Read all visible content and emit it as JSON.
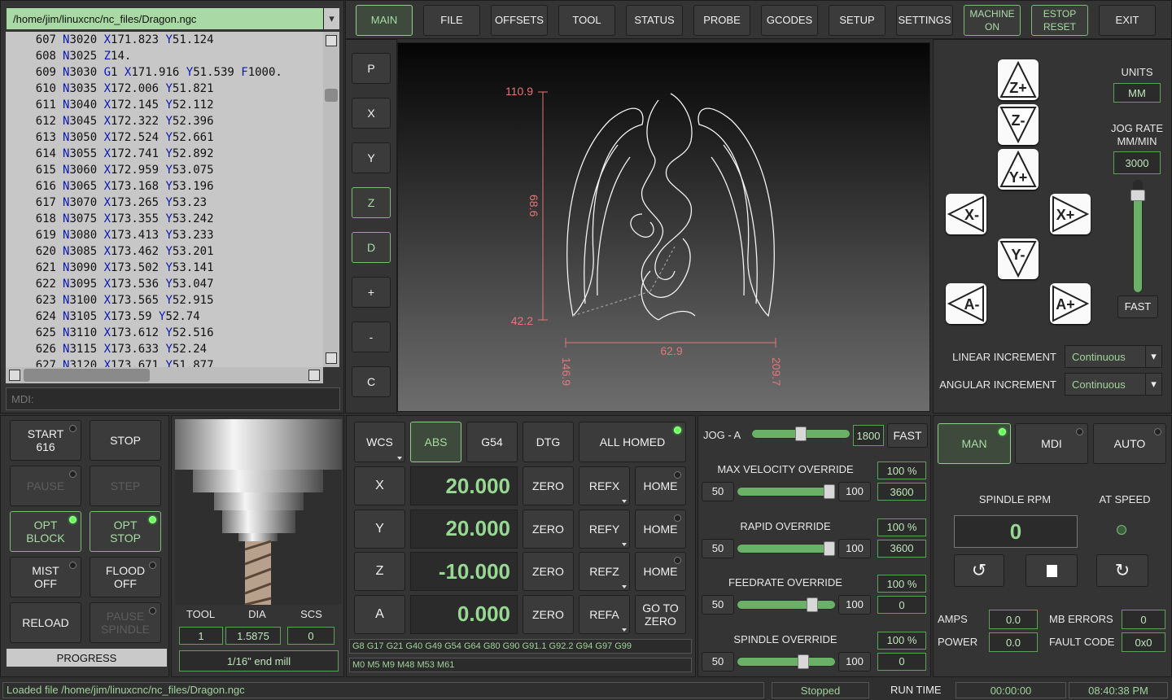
{
  "file_path": "/home/jim/linuxcnc/nc_files/Dragon.ngc",
  "gcode_lines": [
    {
      "n": "607",
      "t": [
        [
          "N",
          "3020"
        ],
        [
          "X",
          "171.823"
        ],
        [
          "Y",
          "51.124"
        ]
      ]
    },
    {
      "n": "608",
      "t": [
        [
          "N",
          "3025"
        ],
        [
          "Z",
          "14."
        ]
      ]
    },
    {
      "n": "609",
      "t": [
        [
          "N",
          "3030"
        ],
        [
          "G",
          "1"
        ],
        [
          "X",
          "171.916"
        ],
        [
          "Y",
          "51.539"
        ],
        [
          "F",
          "1000."
        ]
      ]
    },
    {
      "n": "610",
      "t": [
        [
          "N",
          "3035"
        ],
        [
          "X",
          "172.006"
        ],
        [
          "Y",
          "51.821"
        ]
      ]
    },
    {
      "n": "611",
      "t": [
        [
          "N",
          "3040"
        ],
        [
          "X",
          "172.145"
        ],
        [
          "Y",
          "52.112"
        ]
      ]
    },
    {
      "n": "612",
      "t": [
        [
          "N",
          "3045"
        ],
        [
          "X",
          "172.322"
        ],
        [
          "Y",
          "52.396"
        ]
      ]
    },
    {
      "n": "613",
      "t": [
        [
          "N",
          "3050"
        ],
        [
          "X",
          "172.524"
        ],
        [
          "Y",
          "52.661"
        ]
      ]
    },
    {
      "n": "614",
      "t": [
        [
          "N",
          "3055"
        ],
        [
          "X",
          "172.741"
        ],
        [
          "Y",
          "52.892"
        ]
      ]
    },
    {
      "n": "615",
      "t": [
        [
          "N",
          "3060"
        ],
        [
          "X",
          "172.959"
        ],
        [
          "Y",
          "53.075"
        ]
      ]
    },
    {
      "n": "616",
      "t": [
        [
          "N",
          "3065"
        ],
        [
          "X",
          "173.168"
        ],
        [
          "Y",
          "53.196"
        ]
      ]
    },
    {
      "n": "617",
      "t": [
        [
          "N",
          "3070"
        ],
        [
          "X",
          "173.265"
        ],
        [
          "Y",
          "53.23"
        ]
      ]
    },
    {
      "n": "618",
      "t": [
        [
          "N",
          "3075"
        ],
        [
          "X",
          "173.355"
        ],
        [
          "Y",
          "53.242"
        ]
      ]
    },
    {
      "n": "619",
      "t": [
        [
          "N",
          "3080"
        ],
        [
          "X",
          "173.413"
        ],
        [
          "Y",
          "53.233"
        ]
      ]
    },
    {
      "n": "620",
      "t": [
        [
          "N",
          "3085"
        ],
        [
          "X",
          "173.462"
        ],
        [
          "Y",
          "53.201"
        ]
      ]
    },
    {
      "n": "621",
      "t": [
        [
          "N",
          "3090"
        ],
        [
          "X",
          "173.502"
        ],
        [
          "Y",
          "53.141"
        ]
      ]
    },
    {
      "n": "622",
      "t": [
        [
          "N",
          "3095"
        ],
        [
          "X",
          "173.536"
        ],
        [
          "Y",
          "53.047"
        ]
      ]
    },
    {
      "n": "623",
      "t": [
        [
          "N",
          "3100"
        ],
        [
          "X",
          "173.565"
        ],
        [
          "Y",
          "52.915"
        ]
      ]
    },
    {
      "n": "624",
      "t": [
        [
          "N",
          "3105"
        ],
        [
          "X",
          "173.59"
        ],
        [
          "Y",
          "52.74"
        ]
      ]
    },
    {
      "n": "625",
      "t": [
        [
          "N",
          "3110"
        ],
        [
          "X",
          "173.612"
        ],
        [
          "Y",
          "52.516"
        ]
      ]
    },
    {
      "n": "626",
      "t": [
        [
          "N",
          "3115"
        ],
        [
          "X",
          "173.633"
        ],
        [
          "Y",
          "52.24"
        ]
      ]
    },
    {
      "n": "627",
      "t": [
        [
          "N",
          "3120"
        ],
        [
          "X",
          "173.671"
        ],
        [
          "Y",
          "51.877"
        ]
      ]
    }
  ],
  "mdi_label": "MDI:",
  "tabs": [
    "MAIN",
    "FILE",
    "OFFSETS",
    "TOOL",
    "STATUS",
    "PROBE",
    "GCODES",
    "SETUP",
    "SETTINGS",
    "MACHINE ON",
    "ESTOP RESET",
    "EXIT"
  ],
  "side_buttons": [
    "P",
    "X",
    "Y",
    "Z",
    "D",
    "+",
    "-",
    "C"
  ],
  "preview": {
    "y_top": "110.9",
    "y_bottom": "42.2",
    "height": "68.6",
    "width": "62.9",
    "x_left": "146.9",
    "x_right": "209.7"
  },
  "jog": {
    "z_plus": "Z+",
    "z_minus": "Z-",
    "y_plus": "Y+",
    "y_minus": "Y-",
    "x_plus": "X+",
    "x_minus": "X-",
    "a_plus": "A+",
    "a_minus": "A-",
    "units_label": "UNITS",
    "units": "MM",
    "rate_label": "JOG RATE\nMM/MIN",
    "rate": "3000",
    "rate_level": 0.9,
    "fast": "FAST",
    "linear_label": "LINEAR INCREMENT",
    "linear_value": "Continuous",
    "angular_label": "ANGULAR INCREMENT",
    "angular_value": "Continuous"
  },
  "cycle": {
    "start": "START\n616",
    "stop": "STOP",
    "pause": "PAUSE",
    "step": "STEP",
    "opt_block": "OPT\nBLOCK",
    "opt_stop": "OPT\nSTOP",
    "mist": "MIST\nOFF",
    "flood": "FLOOD\nOFF",
    "reload": "RELOAD",
    "pause_spindle": "PAUSE\nSPINDLE",
    "progress": "PROGRESS"
  },
  "tool": {
    "tool_label": "TOOL",
    "dia_label": "DIA",
    "scs_label": "SCS",
    "tool": "1",
    "dia": "1.5875",
    "scs": "0",
    "desc": "1/16\" end mill"
  },
  "dro": {
    "wcs": "WCS",
    "abs": "ABS",
    "g54": "G54",
    "dtg": "DTG",
    "all_homed": "ALL HOMED",
    "axes": [
      {
        "name": "X",
        "value": "20.000",
        "ref": "REFX",
        "home": "HOME"
      },
      {
        "name": "Y",
        "value": "20.000",
        "ref": "REFY",
        "home": "HOME"
      },
      {
        "name": "Z",
        "value": "-10.000",
        "ref": "REFZ",
        "home": "HOME"
      },
      {
        "name": "A",
        "value": "0.000",
        "ref": "REFA",
        "home": "GO TO\nZERO"
      }
    ],
    "zero": "ZERO",
    "gcodes": "G8 G17 G21 G40 G49 G54 G64 G80 G90 G91.1 G92.2 G94 G97 G99",
    "mcodes": "M0 M5 M9 M48 M53 M61"
  },
  "overrides": {
    "jog_label": "JOG - A",
    "jog_value": "1800",
    "jog_level": 0.5,
    "fast": "FAST",
    "items": [
      {
        "label": "MAX VELOCITY OVERRIDE",
        "min": "50",
        "max": "100",
        "pct": "100 %",
        "val": "3600",
        "level": 1.0
      },
      {
        "label": "RAPID OVERRIDE",
        "min": "50",
        "max": "100",
        "pct": "100 %",
        "val": "3600",
        "level": 1.0
      },
      {
        "label": "FEEDRATE OVERRIDE",
        "min": "50",
        "max": "100",
        "pct": "100 %",
        "val": "0",
        "level": 0.8
      },
      {
        "label": "SPINDLE OVERRIDE",
        "min": "50",
        "max": "100",
        "pct": "100 %",
        "val": "0",
        "level": 0.7
      }
    ]
  },
  "spindle": {
    "man": "MAN",
    "mdi": "MDI",
    "auto": "AUTO",
    "rpm_label": "SPINDLE RPM",
    "at_speed": "AT SPEED",
    "rpm": "0",
    "amps_label": "AMPS",
    "amps": "0.0",
    "power_label": "POWER",
    "power": "0.0",
    "mb_label": "MB ERRORS",
    "mb": "0",
    "fault_label": "FAULT CODE",
    "fault": "0x0"
  },
  "status": {
    "message": "Loaded file /home/jim/linuxcnc/nc_files/Dragon.ngc",
    "state": "Stopped",
    "run_label": "RUN TIME",
    "run_time": "00:00:00",
    "clock": "08:40:38 PM"
  },
  "colors": {
    "accent": "#8ecd8a",
    "dro_text": "#97d893",
    "dimension": "#e0787a"
  }
}
